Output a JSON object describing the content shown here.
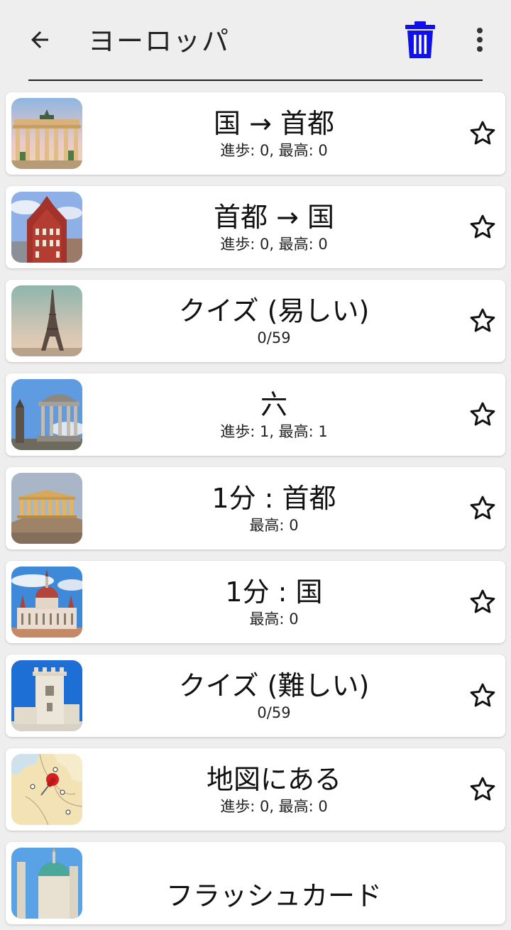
{
  "header": {
    "back_icon": "arrow-left-icon",
    "title": "ヨーロッパ",
    "delete_icon": "trash-icon",
    "delete_color": "#1010e8",
    "more_icon": "more-vert-icon"
  },
  "items": [
    {
      "title": "国 → 首都",
      "subtitle": "進歩: 0, 最高: 0",
      "image": "brandenburg-gate",
      "star": "star-outline-icon"
    },
    {
      "title": "首都 → 国",
      "subtitle": "進歩: 0, 最高: 0",
      "image": "house-of-blackheads",
      "star": "star-outline-icon"
    },
    {
      "title": "クイズ (易しい)",
      "subtitle": "0/59",
      "image": "eiffel-tower",
      "star": "star-outline-icon"
    },
    {
      "title": "六",
      "subtitle": "進歩: 1, 最高: 1",
      "image": "dugald-stewart-monument",
      "star": "star-outline-icon"
    },
    {
      "title": "1分 : 首都",
      "subtitle": "最高: 0",
      "image": "parthenon",
      "star": "star-outline-icon"
    },
    {
      "title": "1分 : 国",
      "subtitle": "最高: 0",
      "image": "hungarian-parliament",
      "star": "star-outline-icon"
    },
    {
      "title": "クイズ (難しい)",
      "subtitle": "0/59",
      "image": "belem-tower",
      "star": "star-outline-icon"
    },
    {
      "title": "地図にある",
      "subtitle": "進歩: 0, 最高: 0",
      "image": "map-pin",
      "star": "star-outline-icon"
    },
    {
      "title": "フラッシュカード",
      "subtitle": "",
      "image": "karlskirche",
      "star": "star-outline-icon"
    }
  ]
}
